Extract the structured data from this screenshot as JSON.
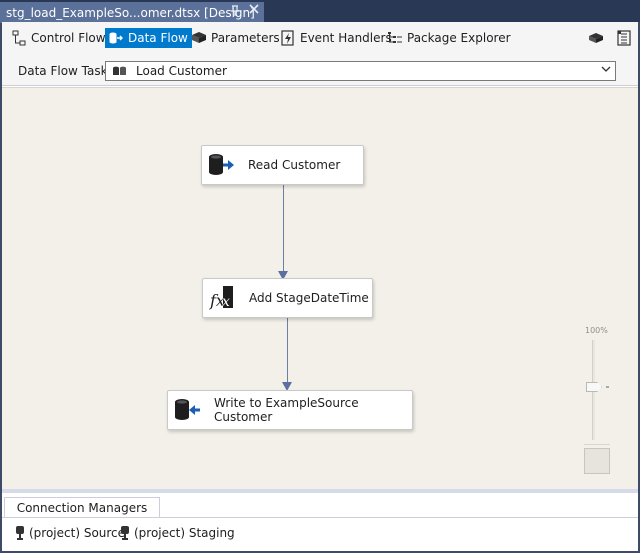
{
  "document_tab": {
    "title": "stg_load_ExampleSo...omer.dtsx [Design]",
    "pin_icon": "pin-icon",
    "close_icon": "close-icon"
  },
  "designer_tabs": [
    {
      "label": "Control Flow",
      "icon": "control-flow-icon",
      "active": false
    },
    {
      "label": "Data Flow",
      "icon": "data-flow-icon",
      "active": true
    },
    {
      "label": "Parameters",
      "icon": "parameters-icon",
      "active": false
    },
    {
      "label": "Event Handlers",
      "icon": "event-handlers-icon",
      "active": false
    },
    {
      "label": "Package Explorer",
      "icon": "package-explorer-icon",
      "active": false
    }
  ],
  "data_flow_task": {
    "label": "Data Flow Task:",
    "selected": "Load Customer"
  },
  "components": [
    {
      "label": "Read Customer",
      "icon": "source-icon"
    },
    {
      "label": "Add StageDateTime",
      "icon": "derived-column-icon"
    },
    {
      "label": "Write to ExampleSource Customer",
      "icon": "destination-icon"
    }
  ],
  "zoom": {
    "label": "100%"
  },
  "connection_managers": {
    "tab_label": "Connection Managers",
    "items": [
      {
        "label": "(project) Source",
        "icon": "connection-icon"
      },
      {
        "label": "(project) Staging",
        "icon": "connection-icon"
      }
    ]
  },
  "colors": {
    "accent": "#007acc",
    "tab_background": "#5b7199",
    "canvas_background": "#f3f0e9",
    "connector": "#6c7fa8"
  }
}
